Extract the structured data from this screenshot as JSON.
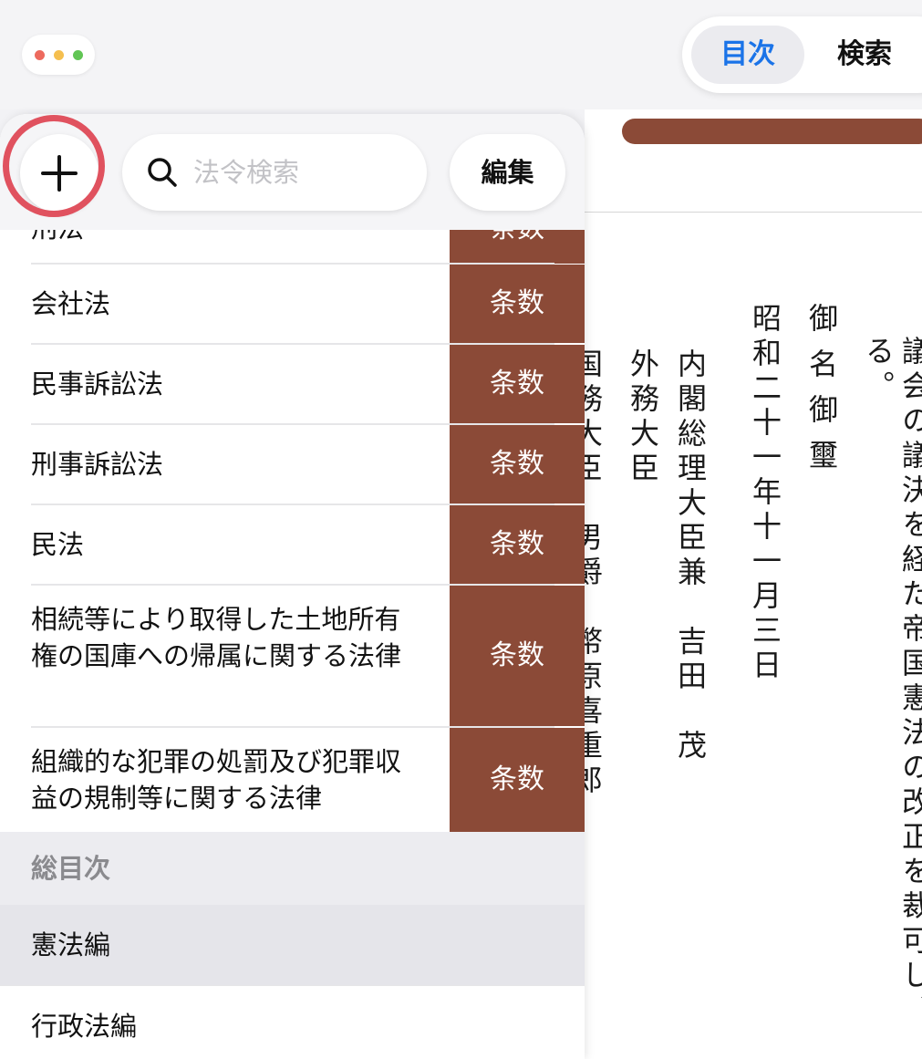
{
  "toolbar": {
    "segments": [
      "目次",
      "検索"
    ],
    "colors": {
      "red": "#ed6a5e",
      "yellow": "#f5bf4f",
      "green": "#61c554",
      "accent": "#1a73e8",
      "brand": "#8b4a37"
    }
  },
  "panel": {
    "add_icon": "plus-icon",
    "search_placeholder": "法令検索",
    "edit_label": "編集",
    "laws": [
      {
        "name": "刑法",
        "count": "条数"
      },
      {
        "name": "会社法",
        "count": "条数"
      },
      {
        "name": "民事訴訟法",
        "count": "条数"
      },
      {
        "name": "刑事訴訟法",
        "count": "条数"
      },
      {
        "name": "民法",
        "count": "条数"
      },
      {
        "name": "相続等により取得した土地所有権の国庫への帰属に関する法律",
        "count": "条数"
      },
      {
        "name": "組織的な犯罪の処罰及び犯罪収益の規制等に関する法律",
        "count": "条数"
      }
    ],
    "section_title": "総目次",
    "sections": [
      "憲法編",
      "行政法編"
    ]
  },
  "document": {
    "columns": [
      "議会の議決を経た帝国憲法の改正を裁可し、",
      "る。",
      "御名御璽",
      "昭和二十一年十一月三日",
      "内閣総理大臣兼　吉田　茂",
      "外務大臣",
      "国務大臣　男爵　幣原喜重郎"
    ]
  }
}
